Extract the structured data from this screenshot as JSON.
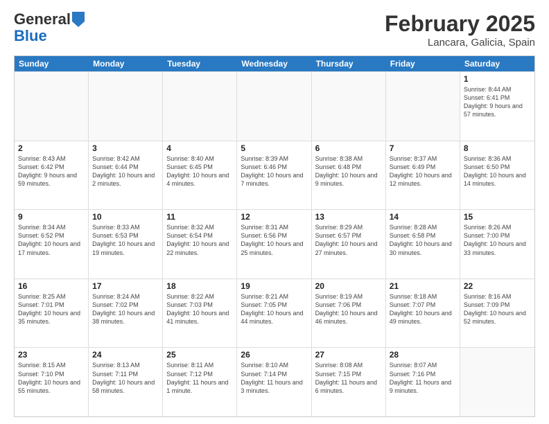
{
  "header": {
    "logo_general": "General",
    "logo_blue": "Blue",
    "title": "February 2025",
    "location": "Lancara, Galicia, Spain"
  },
  "days_of_week": [
    "Sunday",
    "Monday",
    "Tuesday",
    "Wednesday",
    "Thursday",
    "Friday",
    "Saturday"
  ],
  "rows": [
    [
      {
        "day": "",
        "info": ""
      },
      {
        "day": "",
        "info": ""
      },
      {
        "day": "",
        "info": ""
      },
      {
        "day": "",
        "info": ""
      },
      {
        "day": "",
        "info": ""
      },
      {
        "day": "",
        "info": ""
      },
      {
        "day": "1",
        "info": "Sunrise: 8:44 AM\nSunset: 6:41 PM\nDaylight: 9 hours and 57 minutes."
      }
    ],
    [
      {
        "day": "2",
        "info": "Sunrise: 8:43 AM\nSunset: 6:42 PM\nDaylight: 9 hours and 59 minutes."
      },
      {
        "day": "3",
        "info": "Sunrise: 8:42 AM\nSunset: 6:44 PM\nDaylight: 10 hours and 2 minutes."
      },
      {
        "day": "4",
        "info": "Sunrise: 8:40 AM\nSunset: 6:45 PM\nDaylight: 10 hours and 4 minutes."
      },
      {
        "day": "5",
        "info": "Sunrise: 8:39 AM\nSunset: 6:46 PM\nDaylight: 10 hours and 7 minutes."
      },
      {
        "day": "6",
        "info": "Sunrise: 8:38 AM\nSunset: 6:48 PM\nDaylight: 10 hours and 9 minutes."
      },
      {
        "day": "7",
        "info": "Sunrise: 8:37 AM\nSunset: 6:49 PM\nDaylight: 10 hours and 12 minutes."
      },
      {
        "day": "8",
        "info": "Sunrise: 8:36 AM\nSunset: 6:50 PM\nDaylight: 10 hours and 14 minutes."
      }
    ],
    [
      {
        "day": "9",
        "info": "Sunrise: 8:34 AM\nSunset: 6:52 PM\nDaylight: 10 hours and 17 minutes."
      },
      {
        "day": "10",
        "info": "Sunrise: 8:33 AM\nSunset: 6:53 PM\nDaylight: 10 hours and 19 minutes."
      },
      {
        "day": "11",
        "info": "Sunrise: 8:32 AM\nSunset: 6:54 PM\nDaylight: 10 hours and 22 minutes."
      },
      {
        "day": "12",
        "info": "Sunrise: 8:31 AM\nSunset: 6:56 PM\nDaylight: 10 hours and 25 minutes."
      },
      {
        "day": "13",
        "info": "Sunrise: 8:29 AM\nSunset: 6:57 PM\nDaylight: 10 hours and 27 minutes."
      },
      {
        "day": "14",
        "info": "Sunrise: 8:28 AM\nSunset: 6:58 PM\nDaylight: 10 hours and 30 minutes."
      },
      {
        "day": "15",
        "info": "Sunrise: 8:26 AM\nSunset: 7:00 PM\nDaylight: 10 hours and 33 minutes."
      }
    ],
    [
      {
        "day": "16",
        "info": "Sunrise: 8:25 AM\nSunset: 7:01 PM\nDaylight: 10 hours and 35 minutes."
      },
      {
        "day": "17",
        "info": "Sunrise: 8:24 AM\nSunset: 7:02 PM\nDaylight: 10 hours and 38 minutes."
      },
      {
        "day": "18",
        "info": "Sunrise: 8:22 AM\nSunset: 7:03 PM\nDaylight: 10 hours and 41 minutes."
      },
      {
        "day": "19",
        "info": "Sunrise: 8:21 AM\nSunset: 7:05 PM\nDaylight: 10 hours and 44 minutes."
      },
      {
        "day": "20",
        "info": "Sunrise: 8:19 AM\nSunset: 7:06 PM\nDaylight: 10 hours and 46 minutes."
      },
      {
        "day": "21",
        "info": "Sunrise: 8:18 AM\nSunset: 7:07 PM\nDaylight: 10 hours and 49 minutes."
      },
      {
        "day": "22",
        "info": "Sunrise: 8:16 AM\nSunset: 7:09 PM\nDaylight: 10 hours and 52 minutes."
      }
    ],
    [
      {
        "day": "23",
        "info": "Sunrise: 8:15 AM\nSunset: 7:10 PM\nDaylight: 10 hours and 55 minutes."
      },
      {
        "day": "24",
        "info": "Sunrise: 8:13 AM\nSunset: 7:11 PM\nDaylight: 10 hours and 58 minutes."
      },
      {
        "day": "25",
        "info": "Sunrise: 8:11 AM\nSunset: 7:12 PM\nDaylight: 11 hours and 1 minute."
      },
      {
        "day": "26",
        "info": "Sunrise: 8:10 AM\nSunset: 7:14 PM\nDaylight: 11 hours and 3 minutes."
      },
      {
        "day": "27",
        "info": "Sunrise: 8:08 AM\nSunset: 7:15 PM\nDaylight: 11 hours and 6 minutes."
      },
      {
        "day": "28",
        "info": "Sunrise: 8:07 AM\nSunset: 7:16 PM\nDaylight: 11 hours and 9 minutes."
      },
      {
        "day": "",
        "info": ""
      }
    ]
  ]
}
